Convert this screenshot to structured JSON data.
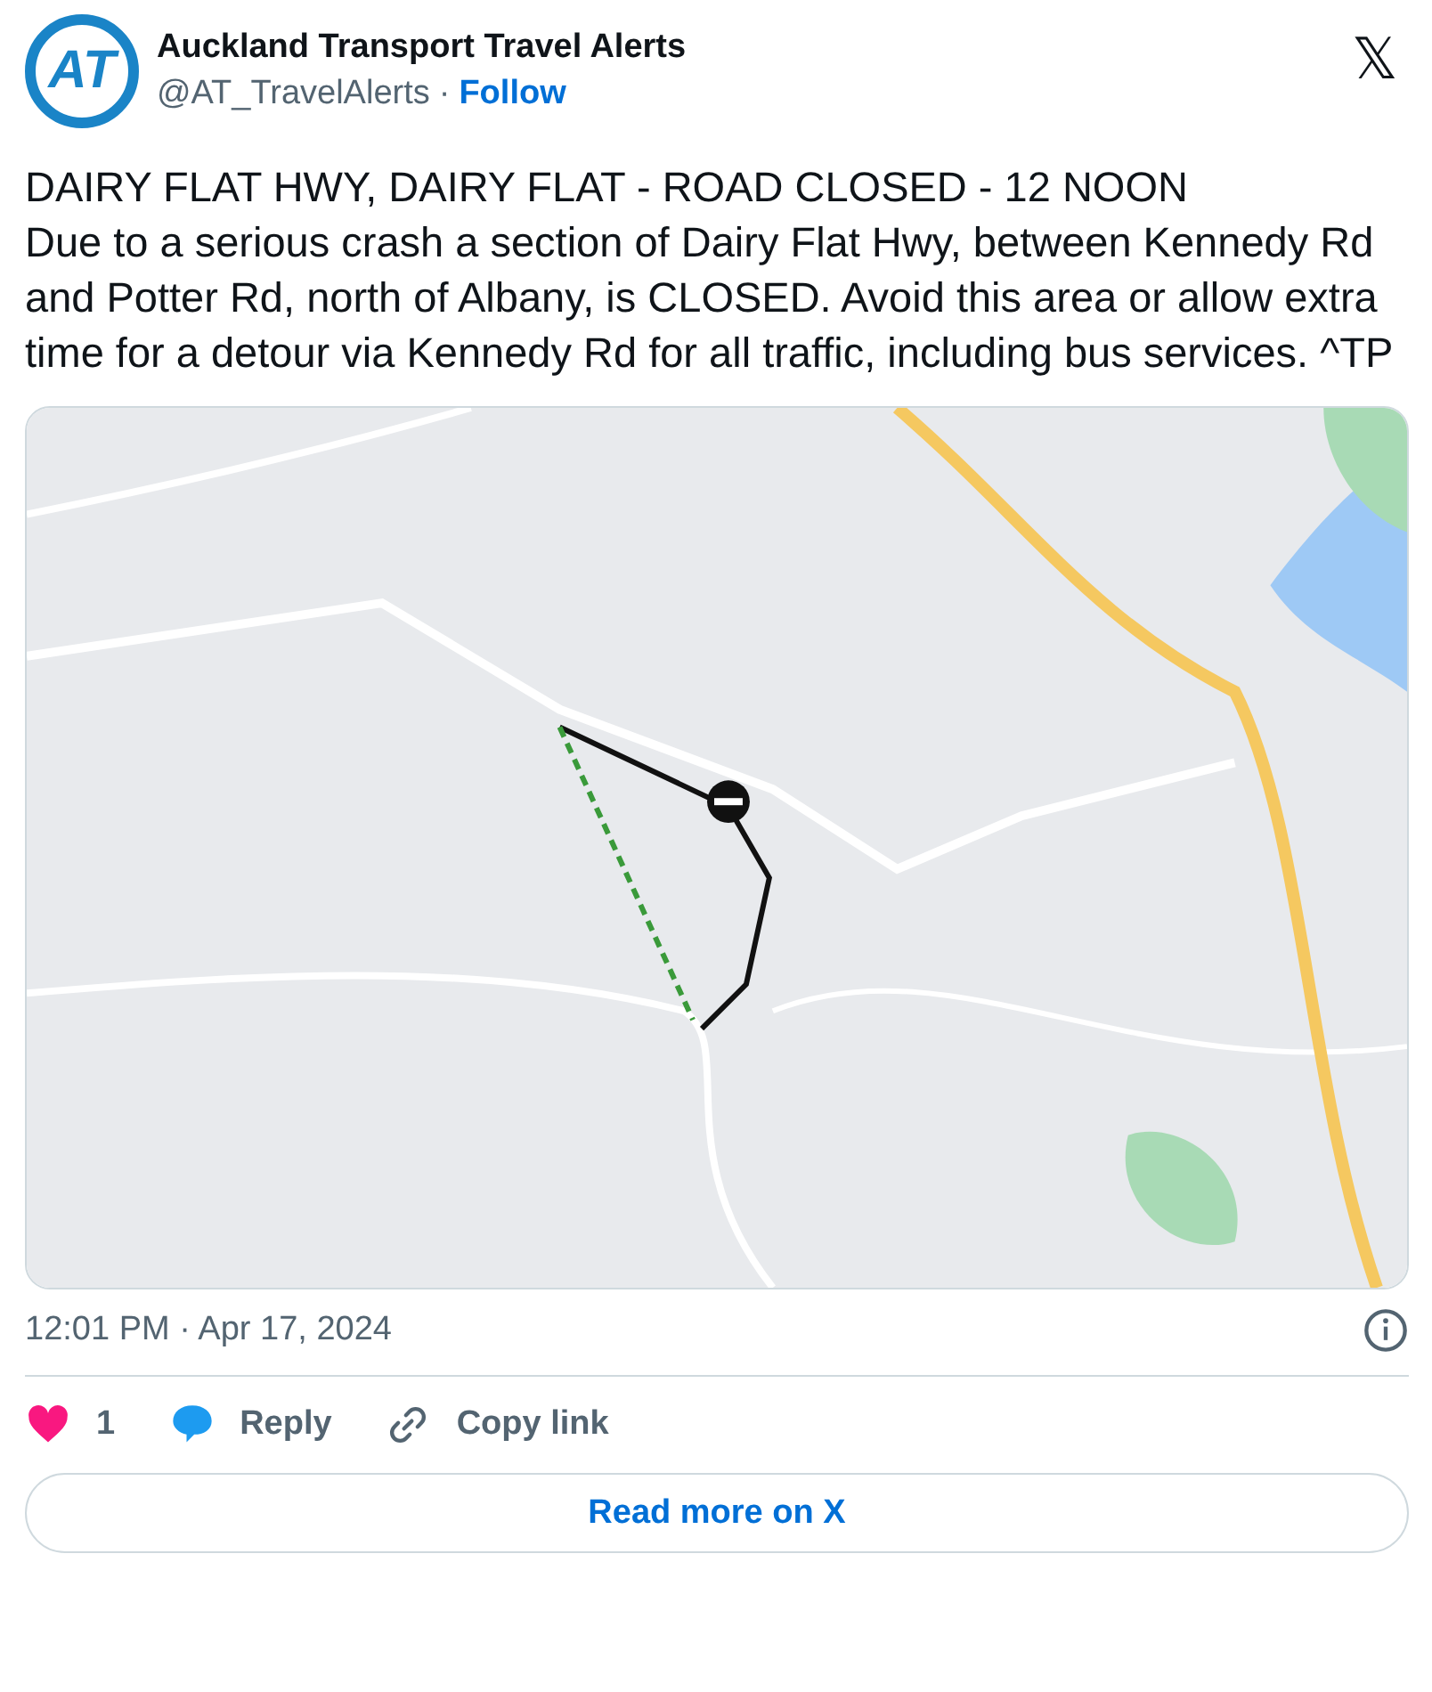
{
  "author": {
    "avatar_text": "AT",
    "name": "Auckland Transport Travel Alerts",
    "handle": "@AT_TravelAlerts",
    "separator": "·",
    "follow": "Follow"
  },
  "close": "𝕏",
  "text": [
    "DAIRY FLAT HWY, DAIRY FLAT - ROAD CLOSED - 12 NOON",
    "Due to a serious crash a section of Dairy Flat Hwy, between Kennedy Rd and Potter Rd, north of Albany, is CLOSED. Avoid this area or allow extra time for a detour via Kennedy Rd for all traffic, including bus services. ^TP"
  ],
  "media": {
    "kind": "picture"
  },
  "timestamp": "12:01 PM · Apr 17, 2024",
  "actions": [
    {
      "kind": "like",
      "label": "1"
    },
    {
      "kind": "reply",
      "label": "Reply"
    },
    {
      "kind": "copy",
      "label": "Copy link"
    }
  ],
  "read_more": "Read more on X"
}
